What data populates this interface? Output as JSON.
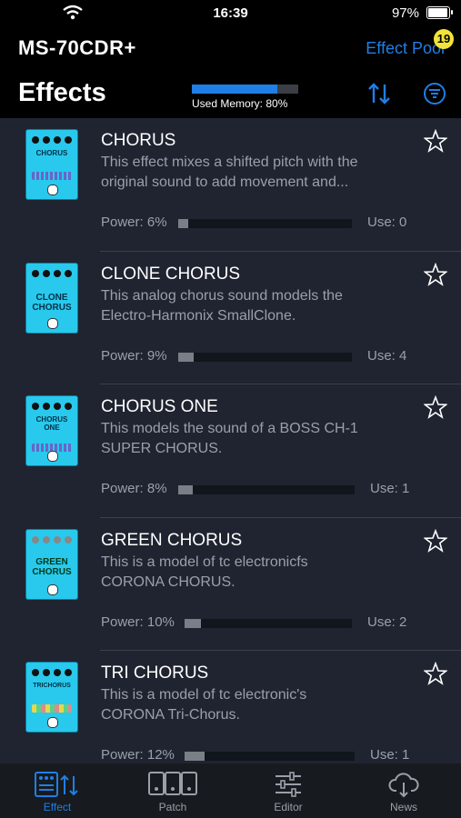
{
  "status": {
    "time": "16:39",
    "battery": "97%"
  },
  "header": {
    "device": "MS-70CDR+",
    "pool_label": "Effect Pool",
    "pool_badge": "19",
    "title": "Effects",
    "memory_label": "Used Memory: 80%",
    "memory_fraction": 0.8
  },
  "effects": [
    {
      "name": "CHORUS",
      "line1": "This effect mixes a shifted pitch with the",
      "line2": "original sound to add movement and...",
      "power": "Power: 6%",
      "power_value": 6,
      "use": "Use: 0",
      "thumb": [
        "CHORUS",
        ""
      ]
    },
    {
      "name": "CLONE CHORUS",
      "line1": "This analog chorus sound models the",
      "line2": "Electro-Harmonix SmallClone.",
      "power": "Power: 9%",
      "power_value": 9,
      "use": "Use: 4",
      "thumb": [
        "CLONE",
        "CHORUS"
      ]
    },
    {
      "name": "CHORUS ONE",
      "line1": "This models the sound of a BOSS CH-1",
      "line2": "SUPER CHORUS.",
      "power": "Power: 8%",
      "power_value": 8,
      "use": "Use: 1",
      "thumb": [
        "CHORUS",
        "ONE"
      ]
    },
    {
      "name": "GREEN CHORUS",
      "line1": "This is a model of tc electronicfs",
      "line2": "CORONA CHORUS.",
      "power": "Power: 10%",
      "power_value": 10,
      "use": "Use: 2",
      "thumb": [
        "GREEN",
        "CHORUS"
      ]
    },
    {
      "name": "TRI CHORUS",
      "line1": "This is a model of tc electronic's",
      "line2": "CORONA Tri-Chorus.",
      "power": "Power: 12%",
      "power_value": 12,
      "use": "Use: 1",
      "thumb": [
        "TRICHORUS",
        ""
      ]
    }
  ],
  "tabs": {
    "effect": "Effect",
    "patch": "Patch",
    "editor": "Editor",
    "news": "News"
  },
  "colors": {
    "accent": "#1f7fe6",
    "badge": "#f3e33a",
    "pedal": "#28c9ec"
  }
}
